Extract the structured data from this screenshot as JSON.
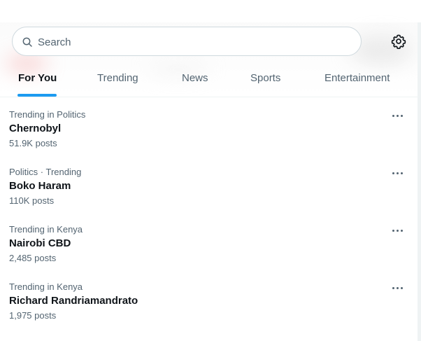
{
  "search": {
    "placeholder": "Search",
    "value": ""
  },
  "icons": {
    "search": "search-icon",
    "settings": "gear-icon",
    "more": "more-horizontal-icon"
  },
  "colors": {
    "accent": "#1d9bf0",
    "primary_text": "#0f1419",
    "secondary_text": "#536471"
  },
  "tabs": [
    {
      "label": "For You",
      "active": true
    },
    {
      "label": "Trending",
      "active": false
    },
    {
      "label": "News",
      "active": false
    },
    {
      "label": "Sports",
      "active": false
    },
    {
      "label": "Entertainment",
      "active": false
    }
  ],
  "trends": [
    {
      "context": "Trending in Politics",
      "name": "Chernobyl",
      "count": "51.9K posts"
    },
    {
      "context": "Politics · Trending",
      "name": "Boko Haram",
      "count": "110K posts"
    },
    {
      "context": "Trending in Kenya",
      "name": "Nairobi CBD",
      "count": "2,485 posts"
    },
    {
      "context": "Trending in Kenya",
      "name": "Richard Randriamandrato",
      "count": "1,975 posts"
    }
  ]
}
